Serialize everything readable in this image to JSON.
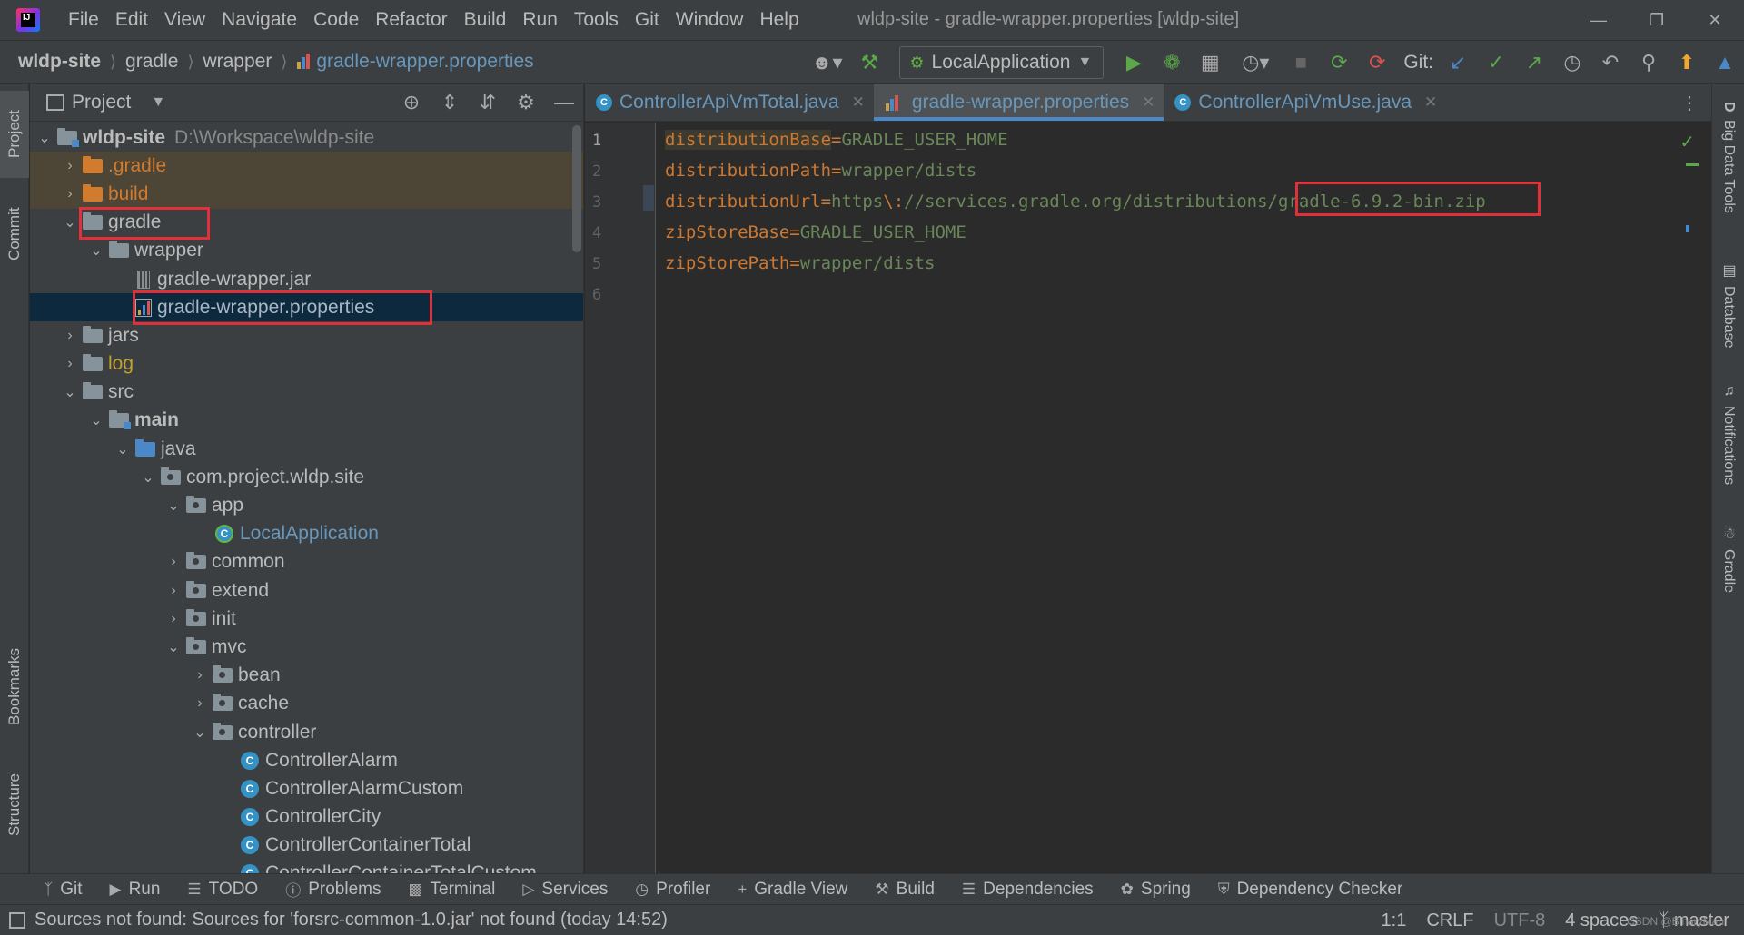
{
  "titlebar": {
    "menu": [
      "File",
      "Edit",
      "View",
      "Navigate",
      "Code",
      "Refactor",
      "Build",
      "Run",
      "Tools",
      "Git",
      "Window",
      "Help"
    ],
    "window_title": "wldp-site - gradle-wrapper.properties [wldp-site]"
  },
  "navbar": {
    "breadcrumbs": [
      "wldp-site",
      "gradle",
      "wrapper",
      "gradle-wrapper.properties"
    ],
    "run_config": "LocalApplication",
    "git_label": "Git:"
  },
  "left_stripe": {
    "tabs": [
      "Project",
      "Commit",
      "Bookmarks",
      "Structure"
    ]
  },
  "project_panel": {
    "title": "Project",
    "tree": [
      {
        "label": "wldp-site",
        "hint": "D:\\Workspace\\wldp-site"
      },
      {
        "label": ".gradle"
      },
      {
        "label": "build"
      },
      {
        "label": "gradle"
      },
      {
        "label": "wrapper"
      },
      {
        "label": "gradle-wrapper.jar"
      },
      {
        "label": "gradle-wrapper.properties"
      },
      {
        "label": "jars"
      },
      {
        "label": "log"
      },
      {
        "label": "src"
      },
      {
        "label": "main"
      },
      {
        "label": "java"
      },
      {
        "label": "com.project.wldp.site"
      },
      {
        "label": "app"
      },
      {
        "label": "LocalApplication"
      },
      {
        "label": "common"
      },
      {
        "label": "extend"
      },
      {
        "label": "init"
      },
      {
        "label": "mvc"
      },
      {
        "label": "bean"
      },
      {
        "label": "cache"
      },
      {
        "label": "controller"
      },
      {
        "label": "ControllerAlarm"
      },
      {
        "label": "ControllerAlarmCustom"
      },
      {
        "label": "ControllerCity"
      },
      {
        "label": "ControllerContainerTotal"
      },
      {
        "label": "ControllerContainerTotalCustom"
      }
    ]
  },
  "editor": {
    "tabs": [
      "ControllerApiVmTotal.java",
      "gradle-wrapper.properties",
      "ControllerApiVmUse.java"
    ],
    "line_numbers": [
      "1",
      "2",
      "3",
      "4",
      "5",
      "6"
    ],
    "lines": [
      {
        "key": "distributionBase",
        "eq": "=",
        "value": "GRADLE_USER_HOME"
      },
      {
        "key": "distributionPath",
        "eq": "=",
        "value": "wrapper/dists"
      },
      {
        "key": "distributionUrl",
        "eq": "=",
        "value_pre": "https",
        "escape": "\\:",
        "value_mid": "//services.gradle.org/distributions",
        "value_post": "/gradle-6.9.2-bin.zip"
      },
      {
        "key": "zipStoreBase",
        "eq": "=",
        "value": "GRADLE_USER_HOME"
      },
      {
        "key": "zipStorePath",
        "eq": "=",
        "value": "wrapper/dists"
      }
    ]
  },
  "right_stripe": {
    "tabs": [
      "Big Data Tools",
      "Database",
      "Notifications",
      "Gradle"
    ]
  },
  "bottom_tools": [
    "Git",
    "Run",
    "TODO",
    "Problems",
    "Terminal",
    "Services",
    "Profiler",
    "Gradle View",
    "Build",
    "Dependencies",
    "Spring",
    "Dependency Checker"
  ],
  "statusbar": {
    "message": "Sources not found: Sources for 'forsrc-common-1.0.jar' not found (today 14:52)",
    "position": "1:1",
    "line_sep": "CRLF",
    "encoding": "UTF-8",
    "indent": "4 spaces",
    "branch": "master"
  },
  "watermark": "CSDN @BinaryMan"
}
